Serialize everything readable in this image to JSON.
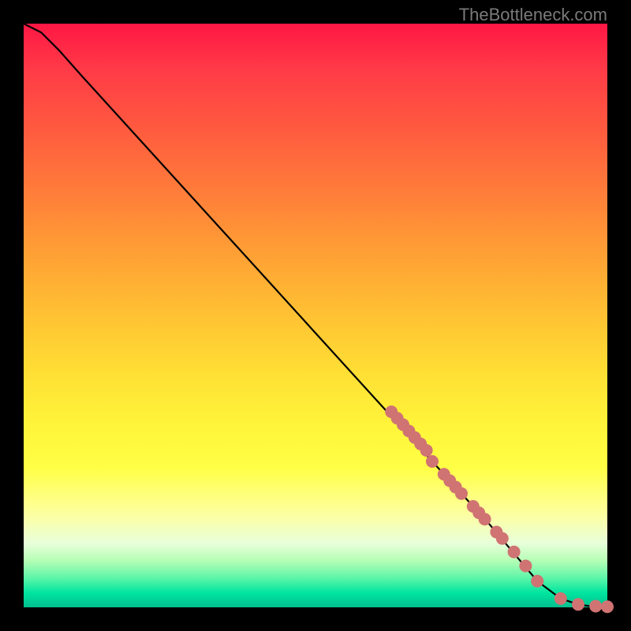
{
  "watermark": "TheBottleneck.com",
  "chart_data": {
    "type": "line",
    "title": "",
    "xlabel": "",
    "ylabel": "",
    "xlim": [
      0,
      100
    ],
    "ylim": [
      0,
      100
    ],
    "grid": false,
    "series": [
      {
        "name": "curve",
        "x": [
          0,
          3,
          6,
          10,
          20,
          30,
          40,
          50,
          60,
          70,
          80,
          88,
          92,
          95,
          97,
          99,
          100
        ],
        "y": [
          100,
          98.5,
          95.5,
          91,
          80,
          69,
          58,
          47,
          36,
          25,
          14,
          4.5,
          1.5,
          0.5,
          0.2,
          0.1,
          0.1
        ]
      }
    ],
    "markers": {
      "x": [
        63,
        64,
        65,
        66,
        67,
        68,
        69,
        70,
        72,
        73,
        74,
        75,
        77,
        78,
        79,
        81,
        82,
        84,
        86,
        88,
        92,
        95,
        98,
        100
      ],
      "y": [
        33.5,
        32.4,
        31.3,
        30.2,
        29.1,
        28.0,
        26.9,
        25.0,
        22.8,
        21.7,
        20.6,
        19.5,
        17.3,
        16.2,
        15.1,
        12.9,
        11.8,
        9.5,
        7.1,
        4.5,
        1.5,
        0.5,
        0.2,
        0.1
      ],
      "color": "#d07373",
      "size": 8
    }
  }
}
